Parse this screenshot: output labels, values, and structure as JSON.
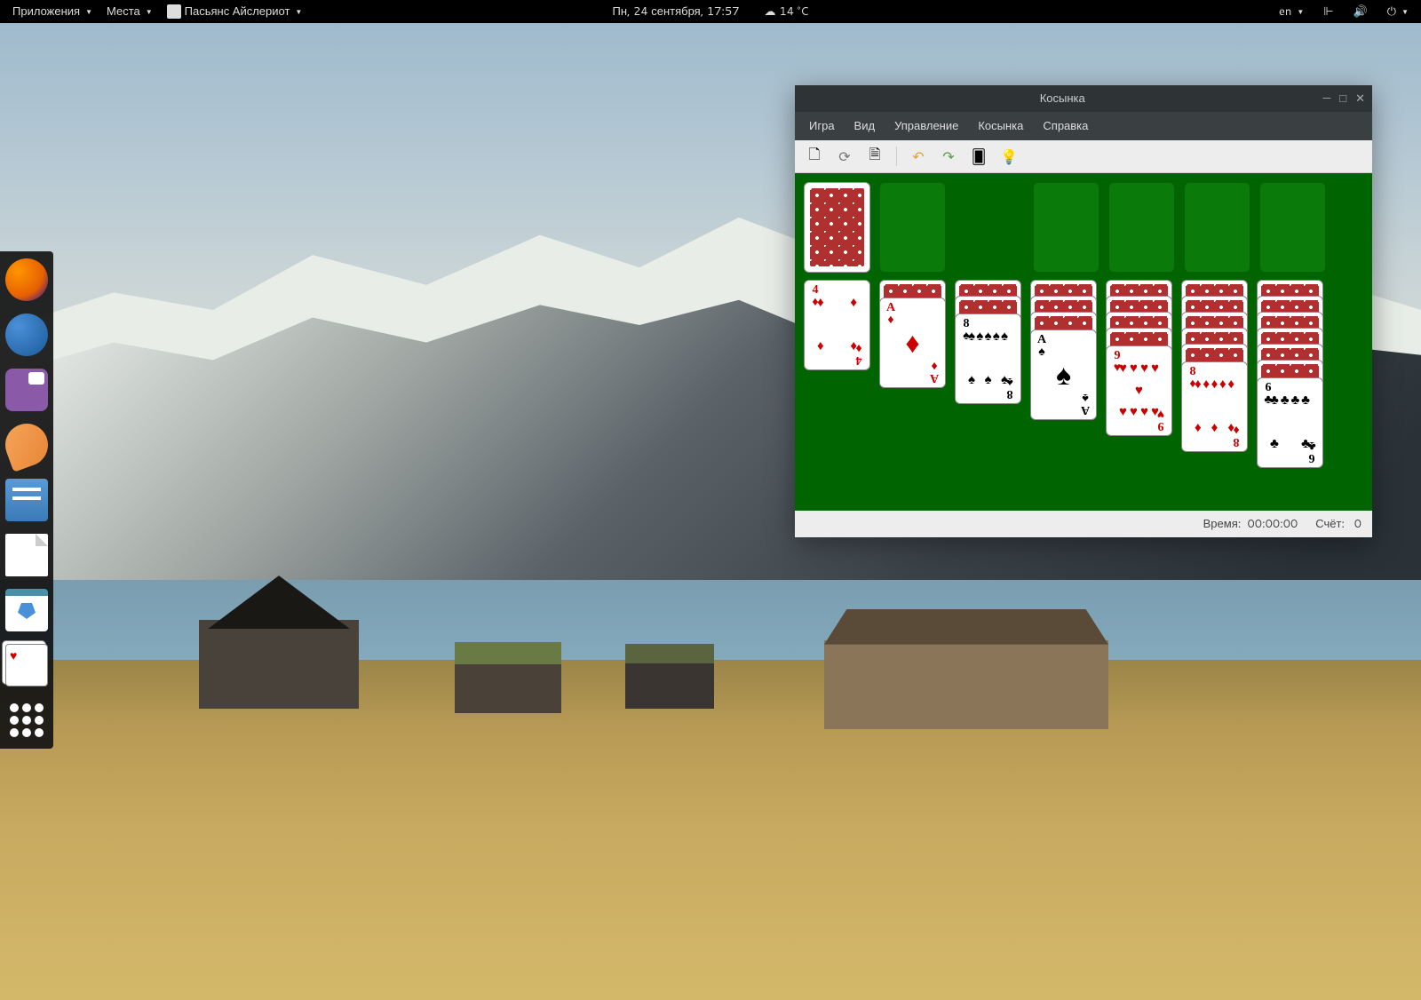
{
  "panel": {
    "applications": "Приложения",
    "places": "Места",
    "active_app": "Пасьянс Айслериот",
    "datetime": "Пн, 24 сентября, 17:57",
    "weather": "14 °C",
    "lang": "en"
  },
  "dock": {
    "items": [
      "firefox",
      "thunderbird",
      "pidgin",
      "amarok",
      "files",
      "document",
      "software",
      "cards",
      "apps-grid"
    ]
  },
  "window": {
    "title": "Косынка",
    "menu": [
      "Игра",
      "Вид",
      "Управление",
      "Косынка",
      "Справка"
    ],
    "status": {
      "time_label": "Время:",
      "time_value": "00:00:00",
      "score_label": "Счёт:",
      "score_value": "0"
    }
  },
  "cards": {
    "c1": {
      "rank": "4",
      "suit": "♦",
      "color": "red"
    },
    "c2": {
      "rank": "A",
      "suit": "♦",
      "color": "red"
    },
    "c3": {
      "rank": "8",
      "suit": "♠",
      "color": "black"
    },
    "c4": {
      "rank": "A",
      "suit": "♠",
      "color": "black"
    },
    "c5": {
      "rank": "9",
      "suit": "♥",
      "color": "red"
    },
    "c6": {
      "rank": "8",
      "suit": "♦",
      "color": "red"
    },
    "c7": {
      "rank": "6",
      "suit": "♣",
      "color": "black"
    }
  }
}
